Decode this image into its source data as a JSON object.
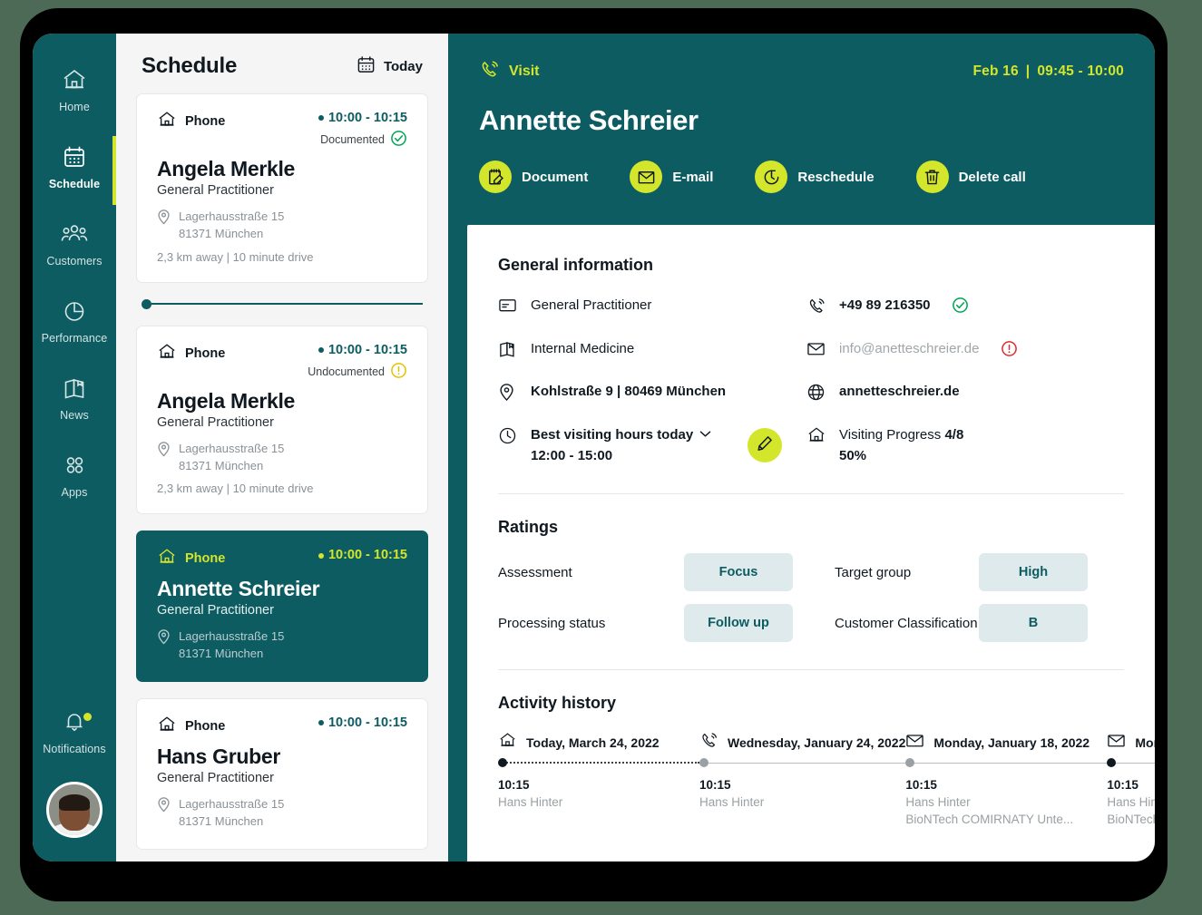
{
  "sidebar": {
    "items": [
      {
        "label": "Home",
        "icon": "home-icon",
        "active": false
      },
      {
        "label": "Schedule",
        "icon": "calendar-icon",
        "active": true
      },
      {
        "label": "Customers",
        "icon": "people-icon",
        "active": false
      },
      {
        "label": "Performance",
        "icon": "pie-chart-icon",
        "active": false
      },
      {
        "label": "News",
        "icon": "book-icon",
        "active": false
      },
      {
        "label": "Apps",
        "icon": "grid-dots-icon",
        "active": false
      }
    ],
    "notifications": {
      "label": "Notifications",
      "icon": "bell-icon",
      "has_badge": true
    },
    "avatar": "user-avatar"
  },
  "schedule": {
    "title": "Schedule",
    "today_button": "Today",
    "today_icon": "calendar-icon",
    "cards": [
      {
        "type": "Phone",
        "type_icon": "home-icon",
        "time": "10:00 - 10:15",
        "status": "Documented",
        "status_icon": "check-circle-icon",
        "name": "Angela Merkle",
        "role": "General Practitioner",
        "street": "Lagerhausstraße 15",
        "city": "81371 München",
        "distance": "2,3 km away  |  10 minute drive",
        "selected": false
      },
      {
        "type": "Phone",
        "type_icon": "home-icon",
        "time": "10:00 - 10:15",
        "status": "Undocumented",
        "status_icon": "warning-circle-icon",
        "name": "Angela Merkle",
        "role": "General Practitioner",
        "street": "Lagerhausstraße 15",
        "city": "81371 München",
        "distance": "2,3 km away  |  10 minute drive",
        "selected": false
      },
      {
        "type": "Phone",
        "type_icon": "home-icon",
        "time": "10:00 - 10:15",
        "status": "",
        "status_icon": "",
        "name": "Annette Schreier",
        "role": "General Practitioner",
        "street": "Lagerhausstraße 15",
        "city": "81371 München",
        "distance": "",
        "selected": true
      },
      {
        "type": "Phone",
        "type_icon": "home-icon",
        "time": "10:00 - 10:15",
        "status": "",
        "status_icon": "",
        "name": "Hans Gruber",
        "role": "General Practitioner",
        "street": "Lagerhausstraße 15",
        "city": "81371 München",
        "distance": "",
        "selected": false
      }
    ]
  },
  "detail": {
    "kind_label": "Visit",
    "kind_icon": "phone-ring-icon",
    "date": "Feb 16",
    "time_range": "09:45 - 10:00",
    "name": "Annette Schreier",
    "actions": [
      {
        "label": "Document",
        "icon": "notepad-pencil-icon"
      },
      {
        "label": "E-mail",
        "icon": "envelope-icon"
      },
      {
        "label": "Reschedule",
        "icon": "clock-arrow-icon"
      },
      {
        "label": "Delete call",
        "icon": "trash-icon"
      }
    ],
    "general_information": {
      "title": "General information",
      "left": [
        {
          "icon": "card-icon",
          "text": "General Practitioner",
          "style": "normal"
        },
        {
          "icon": "book-icon",
          "text": "Internal Medicine",
          "style": "normal"
        },
        {
          "icon": "pin-icon",
          "text": "Kohlstraße 9  |  80469 München",
          "style": "bold"
        }
      ],
      "hours": {
        "icon": "clock-icon",
        "label": "Best visiting hours today",
        "chevron": "chevron-down-icon",
        "value": "12:00 - 15:00",
        "edit_icon": "pencil-icon"
      },
      "right": [
        {
          "icon": "phone-ring-icon",
          "text": "+49 89 216350",
          "style": "bold",
          "status_icon": "check-circle-icon"
        },
        {
          "icon": "envelope-icon",
          "text": "info@anetteschreier.de",
          "style": "muted",
          "status_icon": "error-circle-icon"
        },
        {
          "icon": "globe-icon",
          "text": "annetteschreier.de",
          "style": "bold",
          "status_icon": ""
        }
      ],
      "progress": {
        "icon": "home-icon",
        "label": "Visiting Progress",
        "value": "4/8",
        "percent": "50%"
      }
    },
    "ratings": {
      "title": "Ratings",
      "rows": [
        {
          "label": "Assessment",
          "value": "Focus",
          "label2": "Target group",
          "value2": "High"
        },
        {
          "label": "Processing status",
          "value": "Follow up",
          "label2": "Customer Classification",
          "value2": "B"
        }
      ]
    },
    "activity_history": {
      "title": "Activity history",
      "items": [
        {
          "icon": "home-icon",
          "date": "Today, March 24, 2022",
          "time": "10:15",
          "person": "Hans Hinter",
          "detail": "",
          "node": "dark",
          "segment": "dotted"
        },
        {
          "icon": "phone-ring-icon",
          "date": "Wednesday, January 24, 2022",
          "time": "10:15",
          "person": "Hans Hinter",
          "detail": "",
          "node": "light",
          "segment": "solid"
        },
        {
          "icon": "envelope-icon",
          "date": "Monday, January 18, 2022",
          "time": "10:15",
          "person": "Hans Hinter",
          "detail": "BioNTech COMIRNATY Unte...",
          "node": "light",
          "segment": "solid"
        },
        {
          "icon": "envelope-icon",
          "date": "Monda",
          "time": "10:15",
          "person": "Hans Hinte",
          "detail": "BioNTech",
          "node": "dark",
          "segment": "solid"
        }
      ]
    }
  },
  "colors": {
    "teal": "#0c5c62",
    "accent_lime": "#d4e62b",
    "green_ok": "#00a355",
    "yellow_warn": "#e0c400",
    "red_error": "#e02b2b",
    "pill_bg": "#dfeaec",
    "page_bg": "#4d6a56"
  }
}
